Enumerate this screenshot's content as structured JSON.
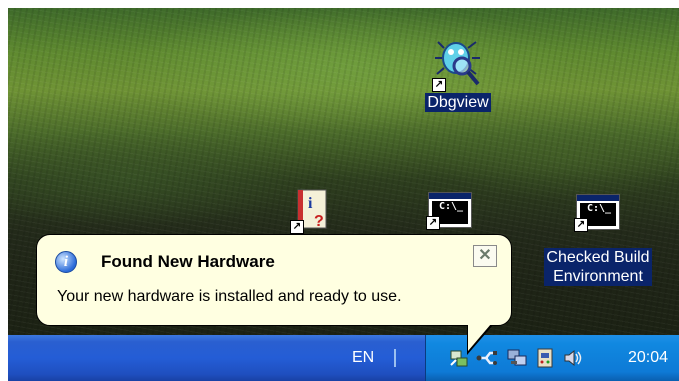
{
  "desktop": {
    "icons": [
      {
        "label": "Dbgview",
        "icon": "bug-magnifier-icon"
      },
      {
        "label": "",
        "icon": "help-document-icon"
      },
      {
        "label": "",
        "icon": "console-icon",
        "glyph": "C:\\_"
      },
      {
        "label_line1": "Checked Build",
        "label_line2": "Environment",
        "icon": "console-icon",
        "glyph": "C:\\_"
      }
    ],
    "shortcut_glyph": "↗"
  },
  "balloon": {
    "title": "Found New Hardware",
    "text": "Your new hardware is installed and ready to use.",
    "close_glyph": "✕",
    "info_glyph": "i"
  },
  "taskbar": {
    "language": "EN",
    "clock": "20:04",
    "tray_icons": [
      "network-icon",
      "safely-remove-hardware-icon",
      "network-connection-icon",
      "usb-device-icon",
      "volume-icon"
    ]
  },
  "colors": {
    "taskbar": "#245dd6",
    "tray": "#0e7ad6",
    "balloon": "#ffffe1",
    "selection": "#0a246a"
  }
}
